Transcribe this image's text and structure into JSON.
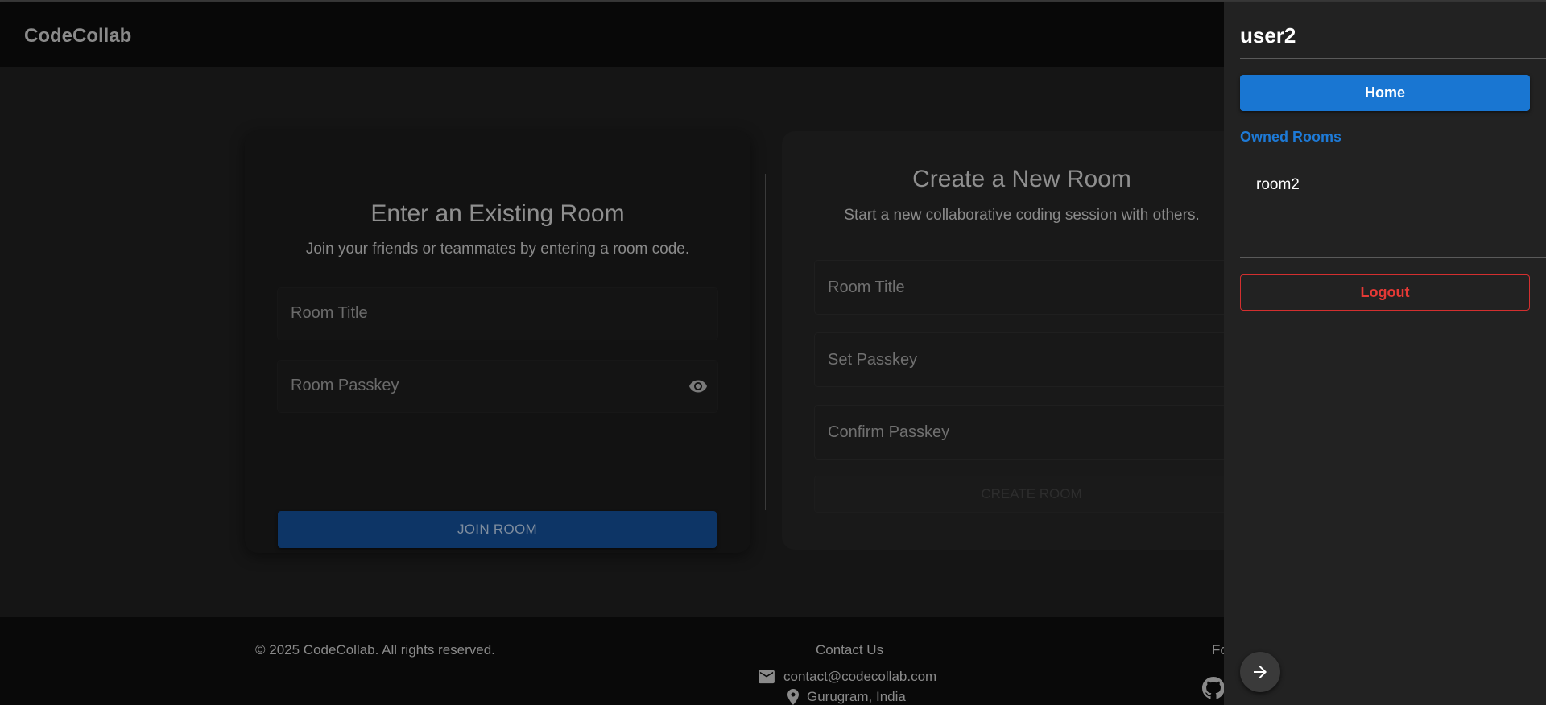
{
  "navbar": {
    "brand": "CodeCollab"
  },
  "join": {
    "title": "Enter an Existing Room",
    "subtitle": "Join your friends or teammates by entering a room code.",
    "room_title_placeholder": "Room Title",
    "room_passkey_placeholder": "Room Passkey",
    "button": "JOIN ROOM"
  },
  "create": {
    "title": "Create a New Room",
    "subtitle": "Start a new collaborative coding session with others.",
    "room_title_placeholder": "Room Title",
    "set_passkey_placeholder": "Set Passkey",
    "confirm_passkey_placeholder": "Confirm Passkey",
    "button": "CREATE ROOM"
  },
  "footer": {
    "copyright": "© 2025 CodeCollab. All rights reserved.",
    "contact_title": "Contact Us",
    "email": "contact@codecollab.com",
    "location": "Gurugram, India",
    "follow_partial": "Fo"
  },
  "drawer": {
    "username": "user2",
    "home_button": "Home",
    "owned_rooms_title": "Owned Rooms",
    "rooms": [
      "room2"
    ],
    "logout_button": "Logout"
  },
  "colors": {
    "accent": "#1976d2",
    "danger": "#d32f2f",
    "background": "#151515",
    "drawer": "#222222"
  },
  "icons": [
    "visibility-icon",
    "email-icon",
    "location-icon",
    "github-icon",
    "arrow-right-icon"
  ]
}
